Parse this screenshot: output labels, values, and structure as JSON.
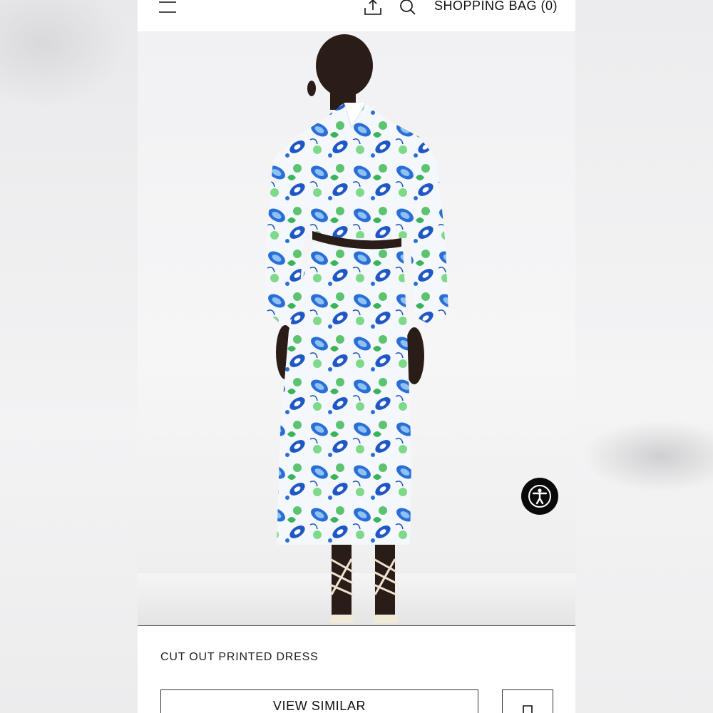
{
  "header": {
    "menu_icon": "hamburger-menu-icon",
    "share_icon": "share-upload-icon",
    "search_icon": "search-icon",
    "bag_label": "SHOPPING BAG (0)"
  },
  "product": {
    "image_icon": "model-photo",
    "name": "CUT OUT PRINTED DRESS",
    "view_similar_label": "VIEW SIMILAR",
    "bookmark_icon": "bookmark-icon"
  },
  "accessibility": {
    "icon": "accessibility-person-icon"
  },
  "colors": {
    "accent": "#111111",
    "background": "#ffffff",
    "print_blue": "#2a6fd6",
    "print_green": "#5cc46e"
  }
}
